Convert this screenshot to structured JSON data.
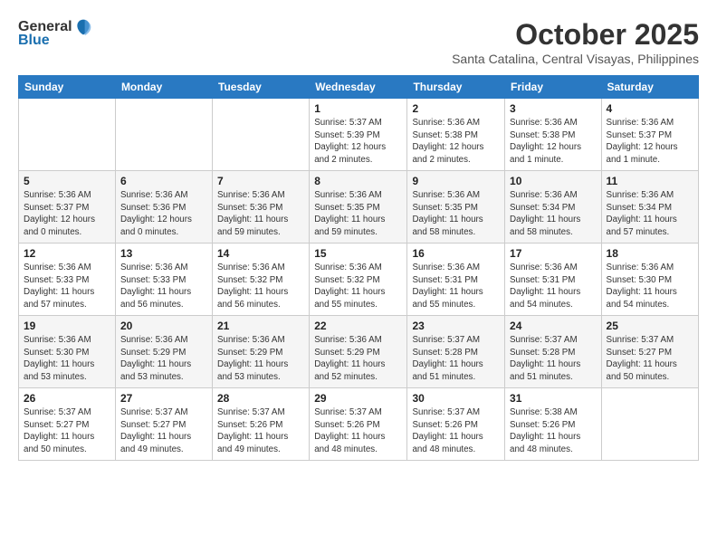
{
  "header": {
    "logo_general": "General",
    "logo_blue": "Blue",
    "month": "October 2025",
    "location": "Santa Catalina, Central Visayas, Philippines"
  },
  "weekdays": [
    "Sunday",
    "Monday",
    "Tuesday",
    "Wednesday",
    "Thursday",
    "Friday",
    "Saturday"
  ],
  "weeks": [
    [
      {
        "day": "",
        "info": ""
      },
      {
        "day": "",
        "info": ""
      },
      {
        "day": "",
        "info": ""
      },
      {
        "day": "1",
        "info": "Sunrise: 5:37 AM\nSunset: 5:39 PM\nDaylight: 12 hours and 2 minutes."
      },
      {
        "day": "2",
        "info": "Sunrise: 5:36 AM\nSunset: 5:38 PM\nDaylight: 12 hours and 2 minutes."
      },
      {
        "day": "3",
        "info": "Sunrise: 5:36 AM\nSunset: 5:38 PM\nDaylight: 12 hours and 1 minute."
      },
      {
        "day": "4",
        "info": "Sunrise: 5:36 AM\nSunset: 5:37 PM\nDaylight: 12 hours and 1 minute."
      }
    ],
    [
      {
        "day": "5",
        "info": "Sunrise: 5:36 AM\nSunset: 5:37 PM\nDaylight: 12 hours and 0 minutes."
      },
      {
        "day": "6",
        "info": "Sunrise: 5:36 AM\nSunset: 5:36 PM\nDaylight: 12 hours and 0 minutes."
      },
      {
        "day": "7",
        "info": "Sunrise: 5:36 AM\nSunset: 5:36 PM\nDaylight: 11 hours and 59 minutes."
      },
      {
        "day": "8",
        "info": "Sunrise: 5:36 AM\nSunset: 5:35 PM\nDaylight: 11 hours and 59 minutes."
      },
      {
        "day": "9",
        "info": "Sunrise: 5:36 AM\nSunset: 5:35 PM\nDaylight: 11 hours and 58 minutes."
      },
      {
        "day": "10",
        "info": "Sunrise: 5:36 AM\nSunset: 5:34 PM\nDaylight: 11 hours and 58 minutes."
      },
      {
        "day": "11",
        "info": "Sunrise: 5:36 AM\nSunset: 5:34 PM\nDaylight: 11 hours and 57 minutes."
      }
    ],
    [
      {
        "day": "12",
        "info": "Sunrise: 5:36 AM\nSunset: 5:33 PM\nDaylight: 11 hours and 57 minutes."
      },
      {
        "day": "13",
        "info": "Sunrise: 5:36 AM\nSunset: 5:33 PM\nDaylight: 11 hours and 56 minutes."
      },
      {
        "day": "14",
        "info": "Sunrise: 5:36 AM\nSunset: 5:32 PM\nDaylight: 11 hours and 56 minutes."
      },
      {
        "day": "15",
        "info": "Sunrise: 5:36 AM\nSunset: 5:32 PM\nDaylight: 11 hours and 55 minutes."
      },
      {
        "day": "16",
        "info": "Sunrise: 5:36 AM\nSunset: 5:31 PM\nDaylight: 11 hours and 55 minutes."
      },
      {
        "day": "17",
        "info": "Sunrise: 5:36 AM\nSunset: 5:31 PM\nDaylight: 11 hours and 54 minutes."
      },
      {
        "day": "18",
        "info": "Sunrise: 5:36 AM\nSunset: 5:30 PM\nDaylight: 11 hours and 54 minutes."
      }
    ],
    [
      {
        "day": "19",
        "info": "Sunrise: 5:36 AM\nSunset: 5:30 PM\nDaylight: 11 hours and 53 minutes."
      },
      {
        "day": "20",
        "info": "Sunrise: 5:36 AM\nSunset: 5:29 PM\nDaylight: 11 hours and 53 minutes."
      },
      {
        "day": "21",
        "info": "Sunrise: 5:36 AM\nSunset: 5:29 PM\nDaylight: 11 hours and 53 minutes."
      },
      {
        "day": "22",
        "info": "Sunrise: 5:36 AM\nSunset: 5:29 PM\nDaylight: 11 hours and 52 minutes."
      },
      {
        "day": "23",
        "info": "Sunrise: 5:37 AM\nSunset: 5:28 PM\nDaylight: 11 hours and 51 minutes."
      },
      {
        "day": "24",
        "info": "Sunrise: 5:37 AM\nSunset: 5:28 PM\nDaylight: 11 hours and 51 minutes."
      },
      {
        "day": "25",
        "info": "Sunrise: 5:37 AM\nSunset: 5:27 PM\nDaylight: 11 hours and 50 minutes."
      }
    ],
    [
      {
        "day": "26",
        "info": "Sunrise: 5:37 AM\nSunset: 5:27 PM\nDaylight: 11 hours and 50 minutes."
      },
      {
        "day": "27",
        "info": "Sunrise: 5:37 AM\nSunset: 5:27 PM\nDaylight: 11 hours and 49 minutes."
      },
      {
        "day": "28",
        "info": "Sunrise: 5:37 AM\nSunset: 5:26 PM\nDaylight: 11 hours and 49 minutes."
      },
      {
        "day": "29",
        "info": "Sunrise: 5:37 AM\nSunset: 5:26 PM\nDaylight: 11 hours and 48 minutes."
      },
      {
        "day": "30",
        "info": "Sunrise: 5:37 AM\nSunset: 5:26 PM\nDaylight: 11 hours and 48 minutes."
      },
      {
        "day": "31",
        "info": "Sunrise: 5:38 AM\nSunset: 5:26 PM\nDaylight: 11 hours and 48 minutes."
      },
      {
        "day": "",
        "info": ""
      }
    ]
  ]
}
